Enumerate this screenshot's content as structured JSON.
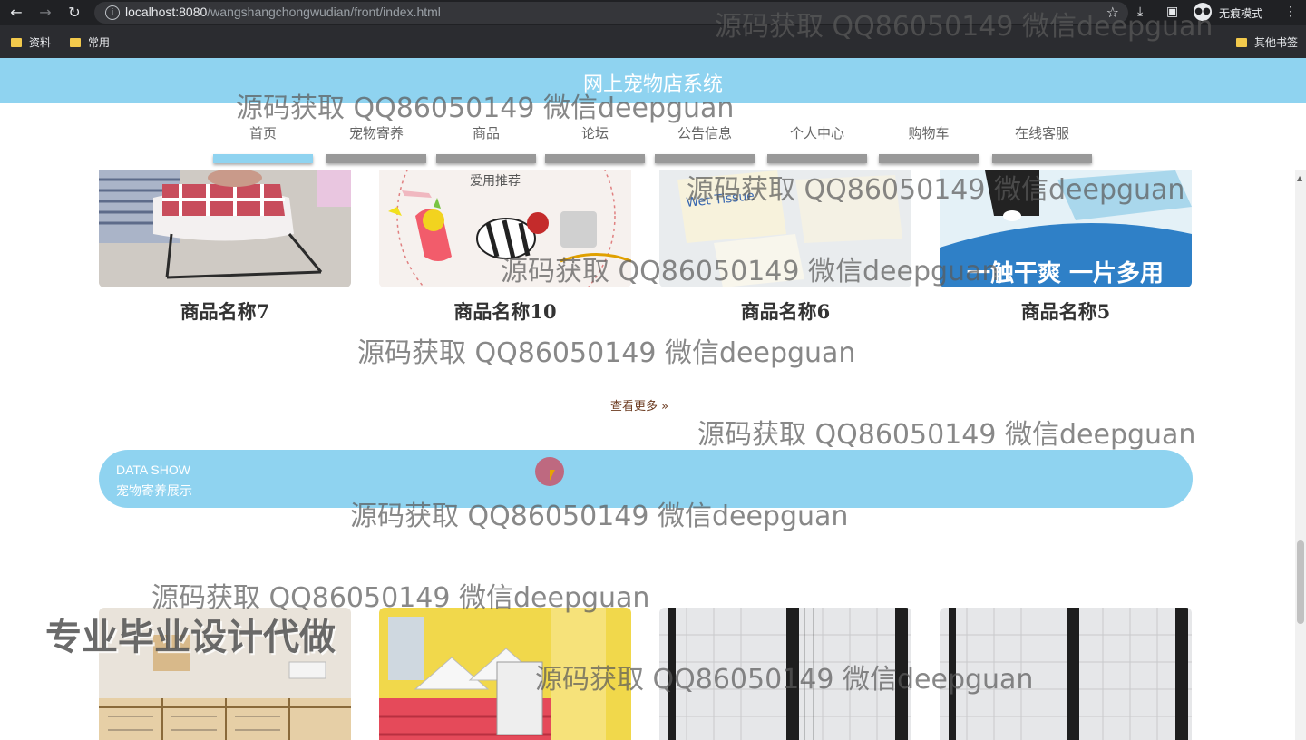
{
  "browser": {
    "url_host": "localhost:8080",
    "url_path": "/wangshangchongwudian/front/index.html",
    "incognito_label": "无痕模式",
    "bookmarks": [
      "资料",
      "常用"
    ],
    "other_bookmarks": "其他书签"
  },
  "site": {
    "title": "网上宠物店系统",
    "nav": [
      "首页",
      "宠物寄养",
      "商品",
      "论坛",
      "公告信息",
      "个人中心",
      "购物车",
      "在线客服"
    ],
    "active_nav": "首页"
  },
  "products": {
    "names": [
      "商品名称7",
      "商品名称10",
      "商品名称6",
      "商品名称5"
    ],
    "image_texts": [
      "爱用推荐",
      "Wet Tissue",
      "一触干爽 一片多用"
    ]
  },
  "more_link": "查看更多",
  "more_icon": "double-chevron-right-icon",
  "section_banner": {
    "title_en": "DATA SHOW",
    "title_cn": "宠物寄养展示"
  },
  "watermarks": {
    "text": "源码获取 QQ86050149 微信deepguan",
    "big": "专业毕业设计代做"
  },
  "colors": {
    "accent": "#8fd3f0",
    "nav_bar_inactive": "#999999"
  }
}
